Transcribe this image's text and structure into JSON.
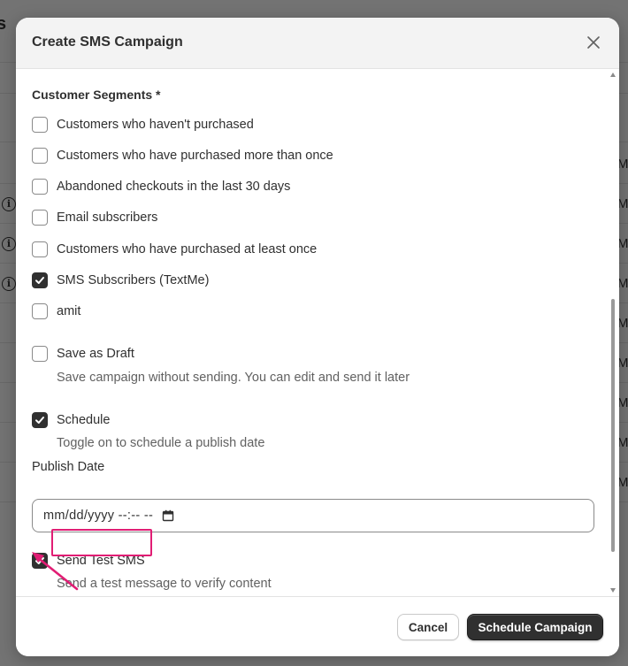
{
  "background": {
    "title_fragment": "s",
    "row_suffixes": [
      "M",
      "M",
      "M",
      "M",
      "M",
      "M",
      "M",
      "M",
      "M"
    ]
  },
  "modal": {
    "title": "Create SMS Campaign",
    "close_icon": "close-icon",
    "segments": {
      "label": "Customer Segments *",
      "options": [
        {
          "label": "Customers who haven't purchased",
          "checked": false
        },
        {
          "label": "Customers who have purchased more than once",
          "checked": false
        },
        {
          "label": "Abandoned checkouts in the last 30 days",
          "checked": false
        },
        {
          "label": "Email subscribers",
          "checked": false
        },
        {
          "label": "Customers who have purchased at least once",
          "checked": false
        },
        {
          "label": "SMS Subscribers (TextMe)",
          "checked": true
        },
        {
          "label": "amit",
          "checked": false
        }
      ]
    },
    "save_as_draft": {
      "label": "Save as Draft",
      "checked": false,
      "help": "Save campaign without sending. You can edit and send it later"
    },
    "schedule": {
      "label": "Schedule",
      "checked": true,
      "help": "Toggle on to schedule a publish date"
    },
    "publish_date": {
      "label": "Publish Date",
      "value": "mm/dd/yyyy --:-- --",
      "icon": "calendar-icon"
    },
    "send_test_sms": {
      "label": "Send Test SMS",
      "checked": true,
      "help": "Send a test message to verify content"
    },
    "footer": {
      "cancel_label": "Cancel",
      "submit_label": "Schedule Campaign"
    }
  },
  "colors": {
    "accent": "#303030",
    "highlight": "#e11d74",
    "overlay": "rgba(0,0,0,0.52)"
  }
}
